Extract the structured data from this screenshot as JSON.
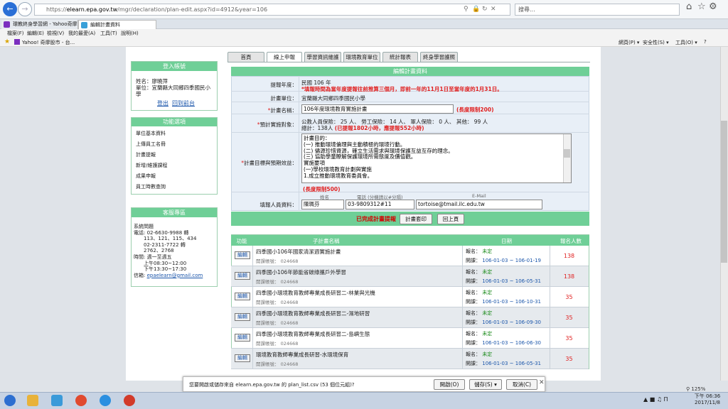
{
  "browser": {
    "url_prefix": "https://",
    "url_host": "elearn.epa.gov.tw",
    "url_path": "/mgr/declaration/plan-edit.aspx?id=4912&year=106",
    "search_placeholder": "搜尋...",
    "tabs": [
      {
        "label": "環教終身學習網 - Yahoo奇摩"
      },
      {
        "label": "編輯計畫資料"
      }
    ],
    "menu": [
      "檔案(F)",
      "編輯(E)",
      "檢視(V)",
      "我的最愛(A)",
      "工具(T)",
      "說明(H)"
    ],
    "favorite": "Yahoo! 奇摩股市 - 台...",
    "tools": [
      "網頁(P) ▾",
      "安全性(S) ▾",
      "工具(O) ▾",
      "?"
    ]
  },
  "nav_tabs": [
    "首頁",
    "線上申報",
    "學習資訊維護",
    "環境教育單位",
    "統計報表",
    "終身學習護照"
  ],
  "login": {
    "header": "登入帳號",
    "name": "姓名：廖曉萍",
    "unit": "單位：宜蘭縣大同鄉四季國民小學",
    "logout": "登出",
    "home": "回到前台"
  },
  "functions": {
    "header": "功能選項",
    "items": [
      "單位基本資料",
      "上傳員工名冊",
      "計畫提報",
      "新增/維護課程",
      "成果申報",
      "員工時數查詢"
    ]
  },
  "service": {
    "header": "客服專區",
    "lines": [
      "系統問題",
      "電話: 02-6630-9988 轉",
      "　　113、121、115、434",
      "　　02-2311-7722 轉",
      "　　2762、2768",
      "時間: 週一至週五",
      "　　上午08:30~12:00",
      "　　下午13:30~17:30"
    ],
    "email_label": "信箱:",
    "email": "epaelearn@gmail.com"
  },
  "form": {
    "header": "編輯計畫資料",
    "year_label": "提報年度：",
    "year": "民國 106 年",
    "year_note": "*填報時間為當年度提報往前推算三個月，即前一年的11月1日至當年度的1月31日。",
    "unit_label": "計畫單位：",
    "unit": "宜蘭縣大同鄉四季國民小學",
    "name_label": "計畫名稱：",
    "name_value": "106年度環境教育實施計畫",
    "name_limit": "(長度限制200)",
    "target_label": "預計實施對象：",
    "target_line1": "公教人員保險： 25 人、 勞工保險： 14 人、 軍人保險： 0 人、 其他： 99 人",
    "target_total": "總計：138人",
    "target_note": "(已提報1802小時，應提報552小時)",
    "goal_label": "計畫目標與預期效益：",
    "goal_text": "計畫目的：\n(一) 推動環境倫理與主動積極的環境行動。\n(二) 儘源珍惜資源，確立生活需求與環境保護互益互存的理念。\n(三) 協助學童瞭解保護環境所需態度及價值觀。\n實施要項\n(一)學校環境教育計劃與實施\n1.成立推動環境教育委員會。",
    "goal_limit": "(長度限制500)",
    "filler_label": "填報人員資料：",
    "col_name": "姓名",
    "col_phone": "電話 (分機請以#分隔)",
    "col_email": "E-Mail",
    "filler_name": "陳珮芬",
    "filler_phone": "03-9809312#11",
    "filler_email": "tortoise@tmail.ilc.edu.tw",
    "status": "已完成計畫提報",
    "print_btn": "計畫套印",
    "back_btn": "回上頁"
  },
  "grid": {
    "headers": [
      "功能",
      "子計畫名稱",
      "日期",
      "報名人數"
    ],
    "edit_label": "編輯",
    "rows": [
      {
        "title": "四季國小106年國家清潔週實施計畫",
        "code": "開課帳號： 024668",
        "signup": "報名：",
        "signup_val": "未定",
        "open": "開課：",
        "dates": "106-01-03 ~ 106-01-19",
        "count": "138"
      },
      {
        "title": "四季國小106年節能省碳綠攜戶外學習",
        "code": "開課帳號： 024668",
        "signup": "報名：",
        "signup_val": "未定",
        "open": "開課：",
        "dates": "106-01-03 ~ 106-05-31",
        "count": "138"
      },
      {
        "title": "四季國小環境教育教師專業成長研習二-林業與光機",
        "code": "開課帳號： 024668",
        "signup": "報名：",
        "signup_val": "未定",
        "open": "開課：",
        "dates": "106-01-03 ~ 106-10-31",
        "count": "35"
      },
      {
        "title": "四季國小環境教育教師專業成長研習二-濕地研習",
        "code": "開課帳號： 024668",
        "signup": "報名：",
        "signup_val": "未定",
        "open": "開課：",
        "dates": "106-01-03 ~ 106-09-30",
        "count": "35"
      },
      {
        "title": "四季國小環境教育教師專業成長研習二-島嶼生態",
        "code": "開課帳號： 024668",
        "signup": "報名：",
        "signup_val": "未定",
        "open": "開課：",
        "dates": "106-01-03 ~ 106-06-30",
        "count": "35"
      },
      {
        "title": "環境教育教師專業成長研習-水環境保育",
        "code": "開課帳號： 024668",
        "signup": "報名：",
        "signup_val": "未定",
        "open": "開課：",
        "dates": "106-01-03 ~ 106-05-31",
        "count": "35"
      }
    ]
  },
  "download": {
    "message": "您要開啟或儲存來自 elearn.epa.gov.tw 的 plan_list.csv (53 個位元組)?",
    "open": "開啟(O)",
    "save": "儲存(S)",
    "cancel": "取消(C)"
  },
  "zoom": "125%",
  "clock": {
    "time": "下午 06:36",
    "date": "2017/11/8"
  }
}
